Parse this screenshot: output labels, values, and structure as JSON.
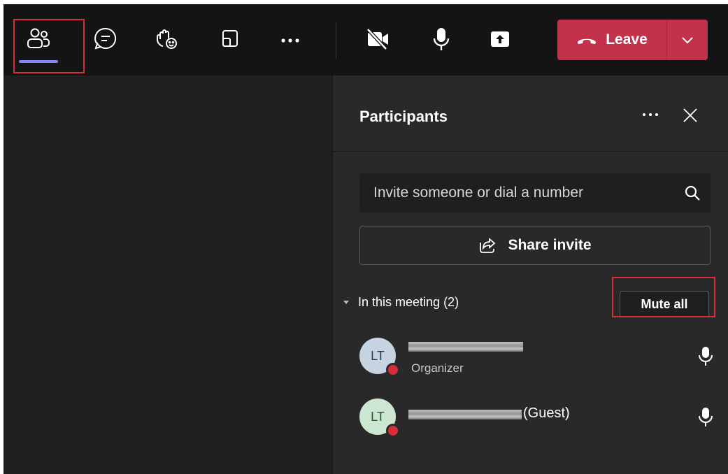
{
  "toolbar": {
    "items": [
      {
        "name": "participants",
        "icon": "people-icon",
        "active": true
      },
      {
        "name": "chat",
        "icon": "chat-icon"
      },
      {
        "name": "react",
        "icon": "raise-hand-icon"
      },
      {
        "name": "rooms",
        "icon": "rooms-icon"
      },
      {
        "name": "more",
        "icon": "more-icon"
      }
    ],
    "controls": [
      {
        "name": "camera",
        "icon": "camera-off-icon"
      },
      {
        "name": "mic",
        "icon": "mic-icon"
      },
      {
        "name": "share",
        "icon": "share-screen-icon"
      }
    ],
    "leave_label": "Leave",
    "accent": "#7f85f5",
    "leave_color": "#c4314b",
    "highlight_color": "#d92d39"
  },
  "panel": {
    "title": "Participants",
    "search_placeholder": "Invite someone or dial a number",
    "share_invite_label": "Share invite",
    "section_label": "In this meeting (2)",
    "mute_all_label": "Mute all",
    "participants": [
      {
        "initials": "LT",
        "role": "Organizer",
        "suffix": "",
        "avatar_bg": "#c6d4e1",
        "avatar_fg": "#2b3b4c"
      },
      {
        "initials": "LT",
        "role": "",
        "suffix": "(Guest)",
        "avatar_bg": "#cde6d2",
        "avatar_fg": "#1e5b2e"
      }
    ]
  }
}
